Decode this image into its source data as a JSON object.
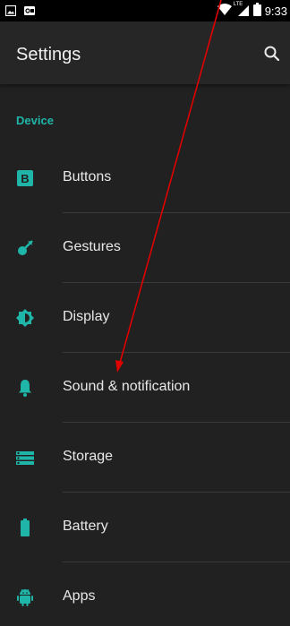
{
  "status_bar": {
    "time": "9:33",
    "network": "LTE"
  },
  "app_bar": {
    "title": "Settings",
    "search_icon": "search-icon"
  },
  "section": {
    "title": "Device"
  },
  "items": [
    {
      "label": "Buttons",
      "icon": "buttons-icon"
    },
    {
      "label": "Gestures",
      "icon": "gestures-icon"
    },
    {
      "label": "Display",
      "icon": "display-icon"
    },
    {
      "label": "Sound & notification",
      "icon": "bell-icon"
    },
    {
      "label": "Storage",
      "icon": "storage-icon"
    },
    {
      "label": "Battery",
      "icon": "battery-icon"
    },
    {
      "label": "Apps",
      "icon": "android-icon"
    }
  ],
  "colors": {
    "accent": "#1fb5a8",
    "background": "#212121",
    "annotation": "#e00000"
  }
}
